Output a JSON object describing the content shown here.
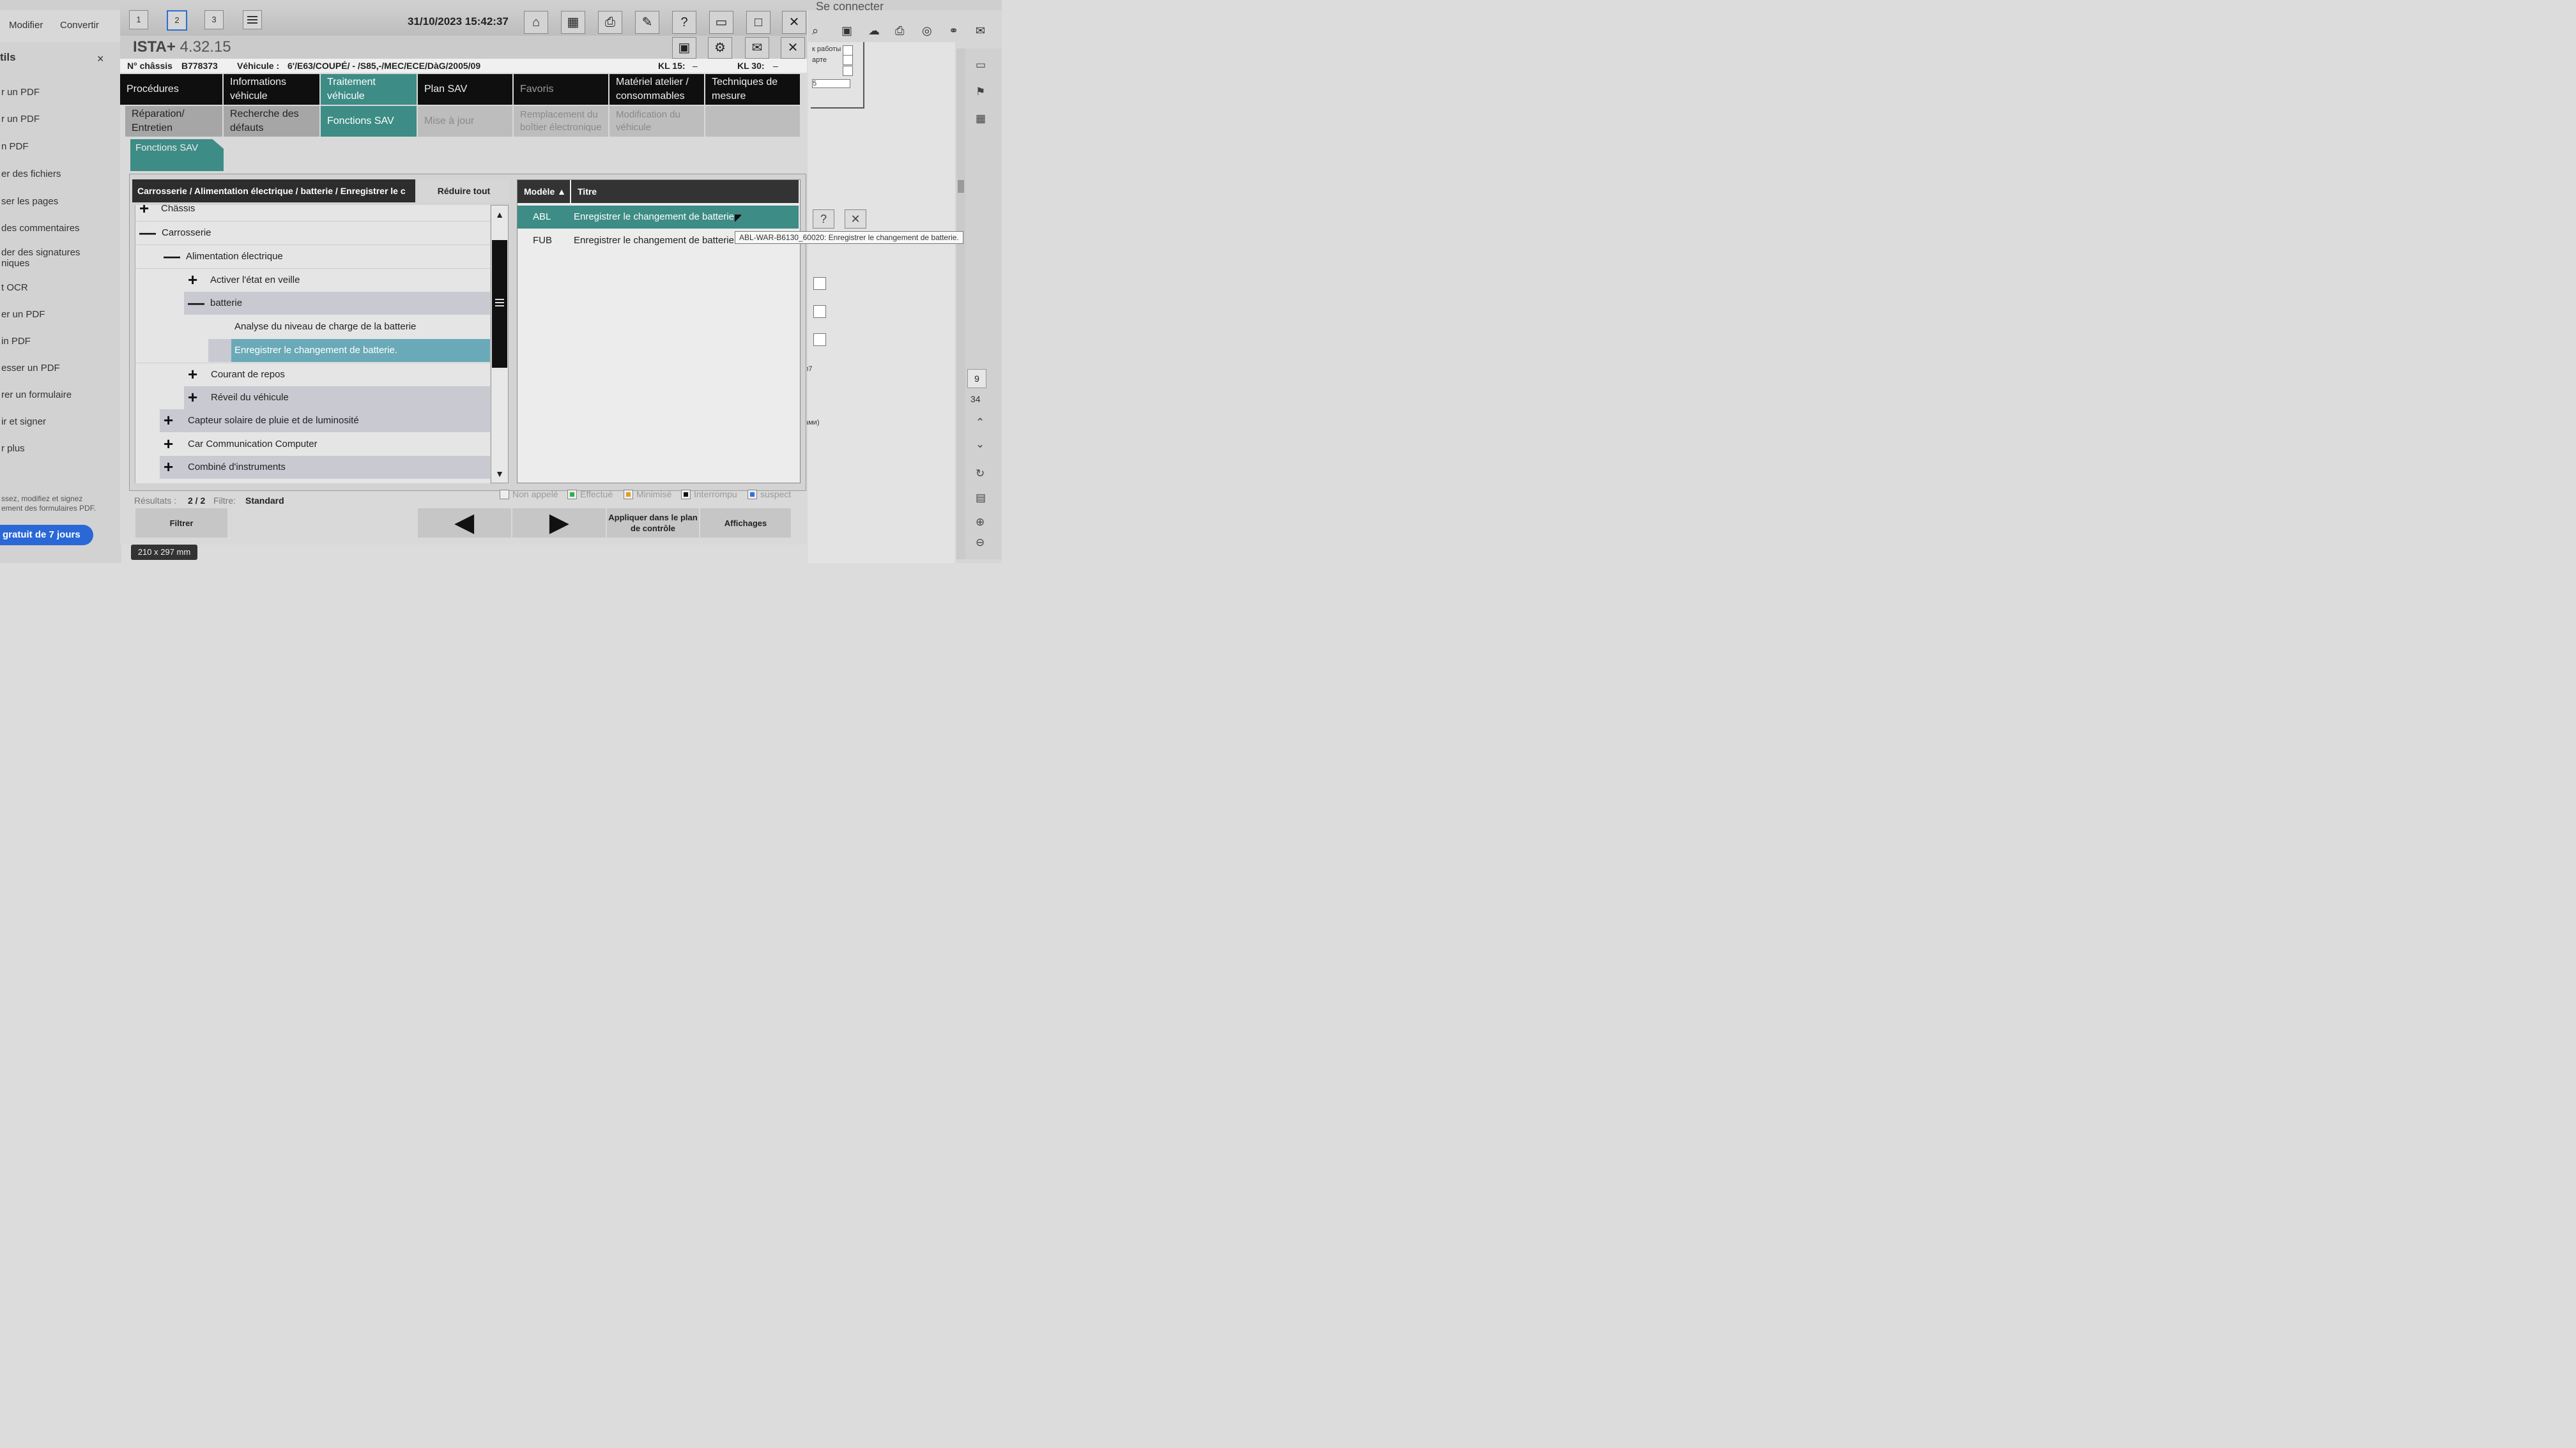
{
  "background_app": {
    "menu": [
      "Modifier",
      "Convertir"
    ],
    "sidebar_title": "tils",
    "sidebar_items": [
      "r un PDF",
      "r un PDF",
      "n PDF",
      "er des fichiers",
      "ser les pages",
      "des commentaires",
      "der des signatures\nniques",
      "t OCR",
      "er un PDF",
      "in PDF",
      "esser un PDF",
      "rer un formulaire",
      "ir et signer",
      "r plus"
    ],
    "promo": "ssez, modifiez et signez\nement des formulaires PDF.",
    "trial": "gratuit de 7 jours",
    "signin": "Se connecter",
    "page_number": "9",
    "page_total": "34",
    "page_size": "210 x 297 mm",
    "doc_fragments": [
      "к работы",
      "арте",
      "л7",
      "ами)",
      "5"
    ]
  },
  "ista": {
    "page_tabs": [
      "1",
      "2",
      "3"
    ],
    "active_page_tab": "2",
    "datetime": "31/10/2023 15:42:37",
    "title": "ISTA+",
    "version": "4.32.15",
    "vehicle": {
      "chassis_label": "N° châssis",
      "chassis": "B778373",
      "vehicle_label": "Véhicule :",
      "vehicle": "6'/E63/COUPÉ/ - /S85,-/MEC/ECE/DàG/2005/09",
      "kl15_label": "KL 15:",
      "kl15_value": "–",
      "kl30_label": "KL 30:",
      "kl30_value": "–"
    },
    "nav_row1": [
      "Procédures",
      "Informations véhicule",
      "Traitement véhicule",
      "Plan SAV",
      "Favoris",
      "Matériel atelier / consommables",
      "Techniques de mesure"
    ],
    "nav_row2": [
      "Réparation/ Entretien",
      "Recherche des défauts",
      "Fonctions SAV",
      "Mise à jour",
      "Remplacement du boîtier électronique",
      "Modification du véhicule",
      ""
    ],
    "sub_tab": "Fonctions SAV",
    "breadcrumb": "Carrosserie / Alimentation électrique / batterie / Enregistrer le c",
    "collapse_all": "Réduire tout",
    "tree": [
      {
        "label": "Châssis",
        "sym": "+"
      },
      {
        "label": "Carrosserie",
        "sym": "—"
      },
      {
        "label": "Alimentation électrique",
        "sym": "—"
      },
      {
        "label": "Activer l'état en veille",
        "sym": "+"
      },
      {
        "label": "batterie",
        "sym": "—"
      },
      {
        "label": "Analyse du niveau de charge de la batterie",
        "sym": ""
      },
      {
        "label": "Enregistrer le changement de batterie.",
        "sym": ""
      },
      {
        "label": "Courant de repos",
        "sym": "+"
      },
      {
        "label": "Réveil du véhicule",
        "sym": "+"
      },
      {
        "label": "Capteur solaire de pluie et de luminosité",
        "sym": "+"
      },
      {
        "label": "Car Communication Computer",
        "sym": "+"
      },
      {
        "label": "Combiné d'instruments",
        "sym": "+"
      }
    ],
    "table": {
      "col_model": "Modèle ▲",
      "col_title": "Titre",
      "rows": [
        {
          "model": "ABL",
          "title": "Enregistrer le changement de batterie."
        },
        {
          "model": "FUB",
          "title": "Enregistrer le changement de batterie."
        }
      ]
    },
    "tooltip": "ABL-WAR-B6130_60020: Enregistrer le changement de batterie.",
    "status": {
      "results_label": "Résultats :",
      "results": "2 / 2",
      "filter_label": "Filtre:",
      "filter": "Standard"
    },
    "legend": [
      {
        "label": "Non appelé",
        "color": "#eeeeee"
      },
      {
        "label": "Effectué",
        "color": "#2db24a"
      },
      {
        "label": "Minimisé",
        "color": "#e0a020"
      },
      {
        "label": "Interrompu",
        "color": "#111111"
      },
      {
        "label": "suspect",
        "color": "#3070e0"
      }
    ],
    "buttons": {
      "filter": "Filtrer",
      "apply": "Appliquer dans le plan de contrôle",
      "displays": "Affichages"
    }
  }
}
